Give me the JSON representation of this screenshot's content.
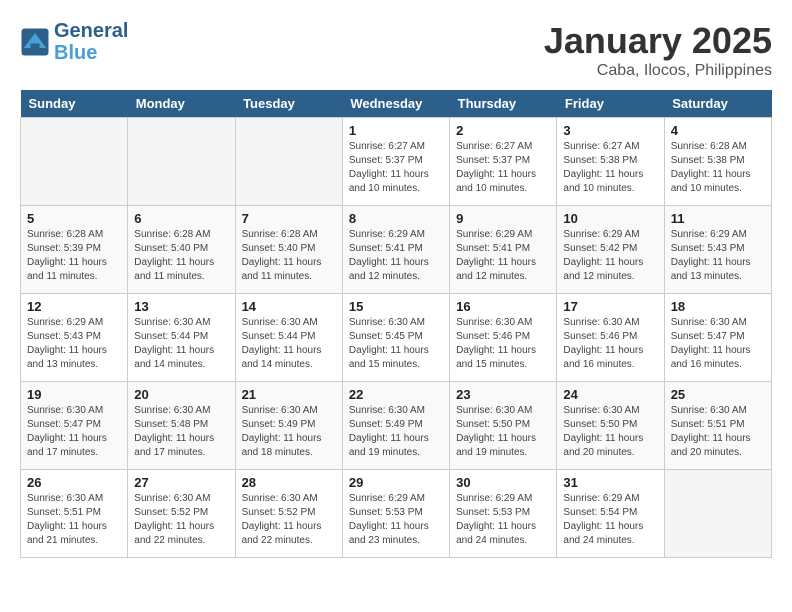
{
  "header": {
    "logo_line1": "General",
    "logo_line2": "Blue",
    "month": "January 2025",
    "location": "Caba, Ilocos, Philippines"
  },
  "days_of_week": [
    "Sunday",
    "Monday",
    "Tuesday",
    "Wednesday",
    "Thursday",
    "Friday",
    "Saturday"
  ],
  "weeks": [
    [
      {
        "day": "",
        "info": ""
      },
      {
        "day": "",
        "info": ""
      },
      {
        "day": "",
        "info": ""
      },
      {
        "day": "1",
        "info": "Sunrise: 6:27 AM\nSunset: 5:37 PM\nDaylight: 11 hours and 10 minutes."
      },
      {
        "day": "2",
        "info": "Sunrise: 6:27 AM\nSunset: 5:37 PM\nDaylight: 11 hours and 10 minutes."
      },
      {
        "day": "3",
        "info": "Sunrise: 6:27 AM\nSunset: 5:38 PM\nDaylight: 11 hours and 10 minutes."
      },
      {
        "day": "4",
        "info": "Sunrise: 6:28 AM\nSunset: 5:38 PM\nDaylight: 11 hours and 10 minutes."
      }
    ],
    [
      {
        "day": "5",
        "info": "Sunrise: 6:28 AM\nSunset: 5:39 PM\nDaylight: 11 hours and 11 minutes."
      },
      {
        "day": "6",
        "info": "Sunrise: 6:28 AM\nSunset: 5:40 PM\nDaylight: 11 hours and 11 minutes."
      },
      {
        "day": "7",
        "info": "Sunrise: 6:28 AM\nSunset: 5:40 PM\nDaylight: 11 hours and 11 minutes."
      },
      {
        "day": "8",
        "info": "Sunrise: 6:29 AM\nSunset: 5:41 PM\nDaylight: 11 hours and 12 minutes."
      },
      {
        "day": "9",
        "info": "Sunrise: 6:29 AM\nSunset: 5:41 PM\nDaylight: 11 hours and 12 minutes."
      },
      {
        "day": "10",
        "info": "Sunrise: 6:29 AM\nSunset: 5:42 PM\nDaylight: 11 hours and 12 minutes."
      },
      {
        "day": "11",
        "info": "Sunrise: 6:29 AM\nSunset: 5:43 PM\nDaylight: 11 hours and 13 minutes."
      }
    ],
    [
      {
        "day": "12",
        "info": "Sunrise: 6:29 AM\nSunset: 5:43 PM\nDaylight: 11 hours and 13 minutes."
      },
      {
        "day": "13",
        "info": "Sunrise: 6:30 AM\nSunset: 5:44 PM\nDaylight: 11 hours and 14 minutes."
      },
      {
        "day": "14",
        "info": "Sunrise: 6:30 AM\nSunset: 5:44 PM\nDaylight: 11 hours and 14 minutes."
      },
      {
        "day": "15",
        "info": "Sunrise: 6:30 AM\nSunset: 5:45 PM\nDaylight: 11 hours and 15 minutes."
      },
      {
        "day": "16",
        "info": "Sunrise: 6:30 AM\nSunset: 5:46 PM\nDaylight: 11 hours and 15 minutes."
      },
      {
        "day": "17",
        "info": "Sunrise: 6:30 AM\nSunset: 5:46 PM\nDaylight: 11 hours and 16 minutes."
      },
      {
        "day": "18",
        "info": "Sunrise: 6:30 AM\nSunset: 5:47 PM\nDaylight: 11 hours and 16 minutes."
      }
    ],
    [
      {
        "day": "19",
        "info": "Sunrise: 6:30 AM\nSunset: 5:47 PM\nDaylight: 11 hours and 17 minutes."
      },
      {
        "day": "20",
        "info": "Sunrise: 6:30 AM\nSunset: 5:48 PM\nDaylight: 11 hours and 17 minutes."
      },
      {
        "day": "21",
        "info": "Sunrise: 6:30 AM\nSunset: 5:49 PM\nDaylight: 11 hours and 18 minutes."
      },
      {
        "day": "22",
        "info": "Sunrise: 6:30 AM\nSunset: 5:49 PM\nDaylight: 11 hours and 19 minutes."
      },
      {
        "day": "23",
        "info": "Sunrise: 6:30 AM\nSunset: 5:50 PM\nDaylight: 11 hours and 19 minutes."
      },
      {
        "day": "24",
        "info": "Sunrise: 6:30 AM\nSunset: 5:50 PM\nDaylight: 11 hours and 20 minutes."
      },
      {
        "day": "25",
        "info": "Sunrise: 6:30 AM\nSunset: 5:51 PM\nDaylight: 11 hours and 20 minutes."
      }
    ],
    [
      {
        "day": "26",
        "info": "Sunrise: 6:30 AM\nSunset: 5:51 PM\nDaylight: 11 hours and 21 minutes."
      },
      {
        "day": "27",
        "info": "Sunrise: 6:30 AM\nSunset: 5:52 PM\nDaylight: 11 hours and 22 minutes."
      },
      {
        "day": "28",
        "info": "Sunrise: 6:30 AM\nSunset: 5:52 PM\nDaylight: 11 hours and 22 minutes."
      },
      {
        "day": "29",
        "info": "Sunrise: 6:29 AM\nSunset: 5:53 PM\nDaylight: 11 hours and 23 minutes."
      },
      {
        "day": "30",
        "info": "Sunrise: 6:29 AM\nSunset: 5:53 PM\nDaylight: 11 hours and 24 minutes."
      },
      {
        "day": "31",
        "info": "Sunrise: 6:29 AM\nSunset: 5:54 PM\nDaylight: 11 hours and 24 minutes."
      },
      {
        "day": "",
        "info": ""
      }
    ]
  ]
}
